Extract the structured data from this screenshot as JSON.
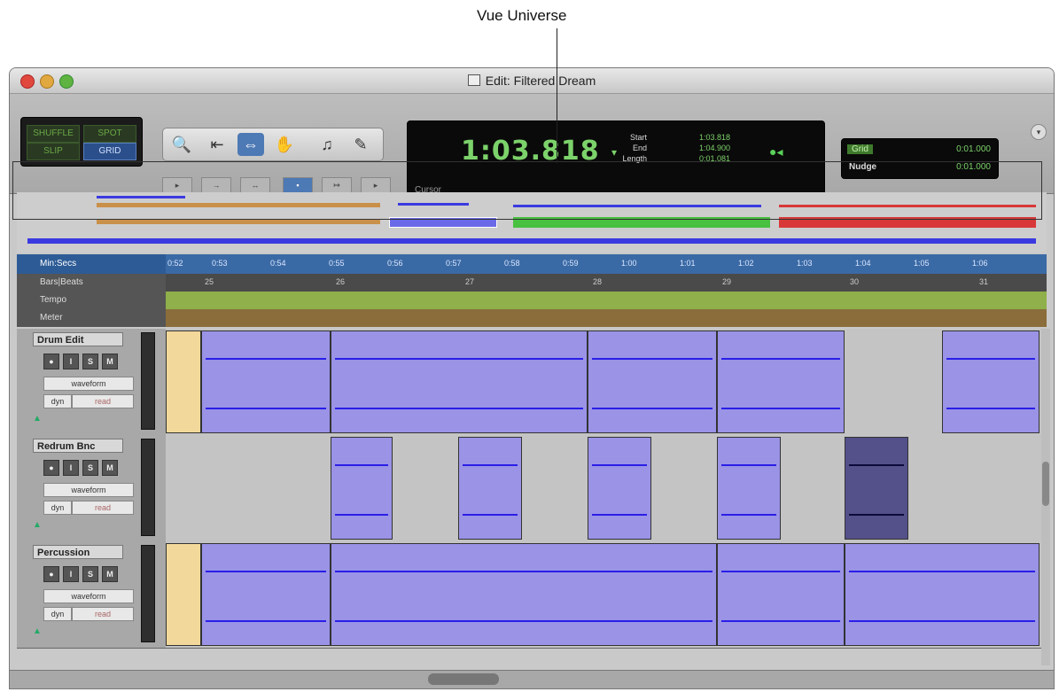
{
  "callout": {
    "label": "Vue Universe"
  },
  "window": {
    "title": "Edit: Filtered Dream"
  },
  "edit_modes": {
    "shuffle": "SHUFFLE",
    "spot": "SPOT",
    "slip": "SLIP",
    "grid": "GRID"
  },
  "tools": {
    "zoom": "zoom-icon",
    "trim": "trim-icon",
    "selector": "selector-icon",
    "grabber": "grabber-icon",
    "scrub": "scrub-icon",
    "pencil": "pencil-icon"
  },
  "counter": {
    "main": "1:03.818",
    "start_label": "Start",
    "end_label": "End",
    "length_label": "Length",
    "start": "1:03.818",
    "end": "1:04.900",
    "length": "0:01.081",
    "cursor_label": "Cursor"
  },
  "grid": {
    "grid_label": "Grid",
    "grid_value": "0:01.000",
    "nudge_label": "Nudge",
    "nudge_value": "0:01.000"
  },
  "rulers": {
    "minsecs_label": "Min:Secs",
    "bars_label": "Bars|Beats",
    "tempo_label": "Tempo",
    "meter_label": "Meter",
    "minsecs_ticks": [
      "0:52",
      "0:53",
      "0:54",
      "0:55",
      "0:56",
      "0:57",
      "0:58",
      "0:59",
      "1:00",
      "1:01",
      "1:02",
      "1:03",
      "1:04",
      "1:05",
      "1:06"
    ],
    "bar_ticks": [
      "25",
      "26",
      "27",
      "28",
      "29",
      "30",
      "31"
    ]
  },
  "tracks": [
    {
      "name": "Drum Edit",
      "view": "waveform",
      "dyn": "dyn",
      "mode": "read"
    },
    {
      "name": "Redrum Bnc",
      "view": "waveform",
      "dyn": "dyn",
      "mode": "read"
    },
    {
      "name": "Percussion",
      "view": "waveform",
      "dyn": "dyn",
      "mode": "read"
    }
  ],
  "track_buttons": {
    "rec": "●",
    "input": "I",
    "solo": "S",
    "mute": "M"
  },
  "colors": {
    "clip": "#9a93e6",
    "clip_dark": "#53508a",
    "waveform": "#2a1ee8",
    "counter_text": "#7cd26a"
  }
}
